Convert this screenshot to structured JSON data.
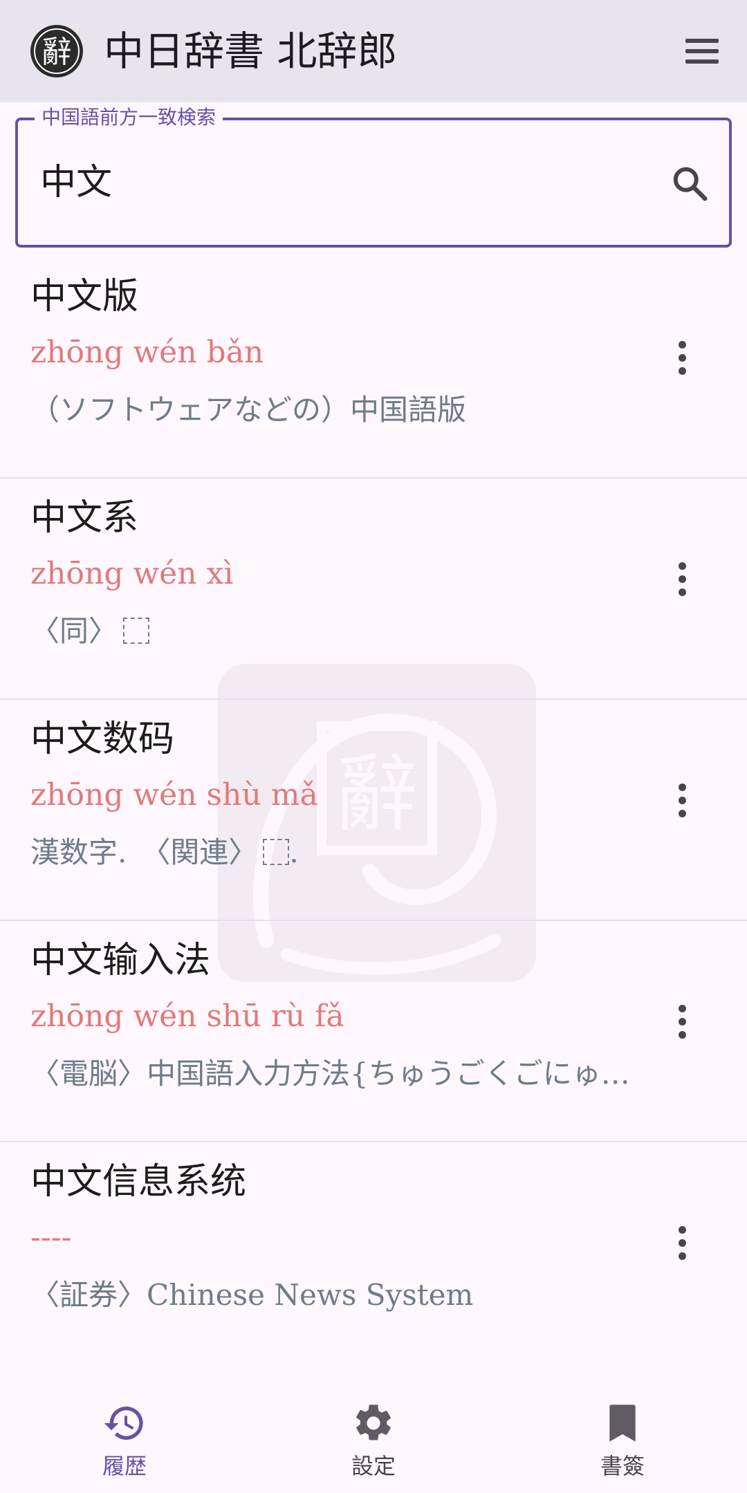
{
  "app": {
    "title": "中日辞書 北辞郎",
    "logo_char": "辭"
  },
  "search": {
    "label": "中国語前方一致検索",
    "value": "中文"
  },
  "results": [
    {
      "word": "中文版",
      "pinyin": "zhōng wén bǎn",
      "meaning": "（ソフトウェアなどの）中国語版"
    },
    {
      "word": "中文系",
      "pinyin": "zhōng wén xì",
      "meaning": "〈同〉"
    },
    {
      "word": "中文数码",
      "pinyin": "zhōng wén shù mǎ",
      "meaning": "漢数字.　〈関連〉",
      "meaning_suffix": "."
    },
    {
      "word": "中文输入法",
      "pinyin": "zhōng wén shū rù fǎ",
      "meaning": "〈電脳〉中国語入力方法{ちゅうごくごにゅ…"
    },
    {
      "word": "中文信息系统",
      "pinyin": "----",
      "meaning": "〈証券〉Chinese News System"
    }
  ],
  "nav": {
    "history_label": "履歴",
    "settings_label": "設定",
    "bookmarks_label": "書簽"
  },
  "colors": {
    "accent": "#6750A4",
    "pinyin": "#E07A7A",
    "meaning": "#6E7C8A",
    "appbar": "#E8E4EE",
    "background": "#FFF7FE"
  },
  "icons": {
    "app_logo": "seal-logo-icon",
    "menu": "hamburger-menu-icon",
    "search": "search-icon",
    "more": "more-vertical-icon",
    "history": "history-icon",
    "settings": "gear-icon",
    "bookmarks": "bookmark-icon"
  }
}
